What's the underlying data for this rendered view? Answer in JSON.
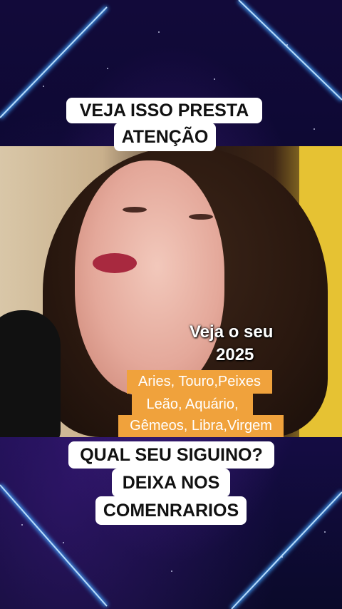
{
  "captions": {
    "top_line1": "VEJA ISSO PRESTA",
    "top_line2": "ATENÇÃO",
    "bottom_line1": "QUAL SEU SIGUINO?",
    "bottom_line2": "DEIXA NOS",
    "bottom_line3": "COMENRARIOS"
  },
  "overlay": {
    "line1": "Veja o seu",
    "line2": "2025"
  },
  "signs": {
    "line1": "Aries, Touro,Peixes",
    "line2": "Leão, Aquário,",
    "line3": "Gêmeos, Libra,Virgem"
  },
  "colors": {
    "background": "#0a0a2a",
    "beam": "#3fa2ff",
    "label_bg": "#f0a23c",
    "caption_bg": "#ffffff"
  }
}
